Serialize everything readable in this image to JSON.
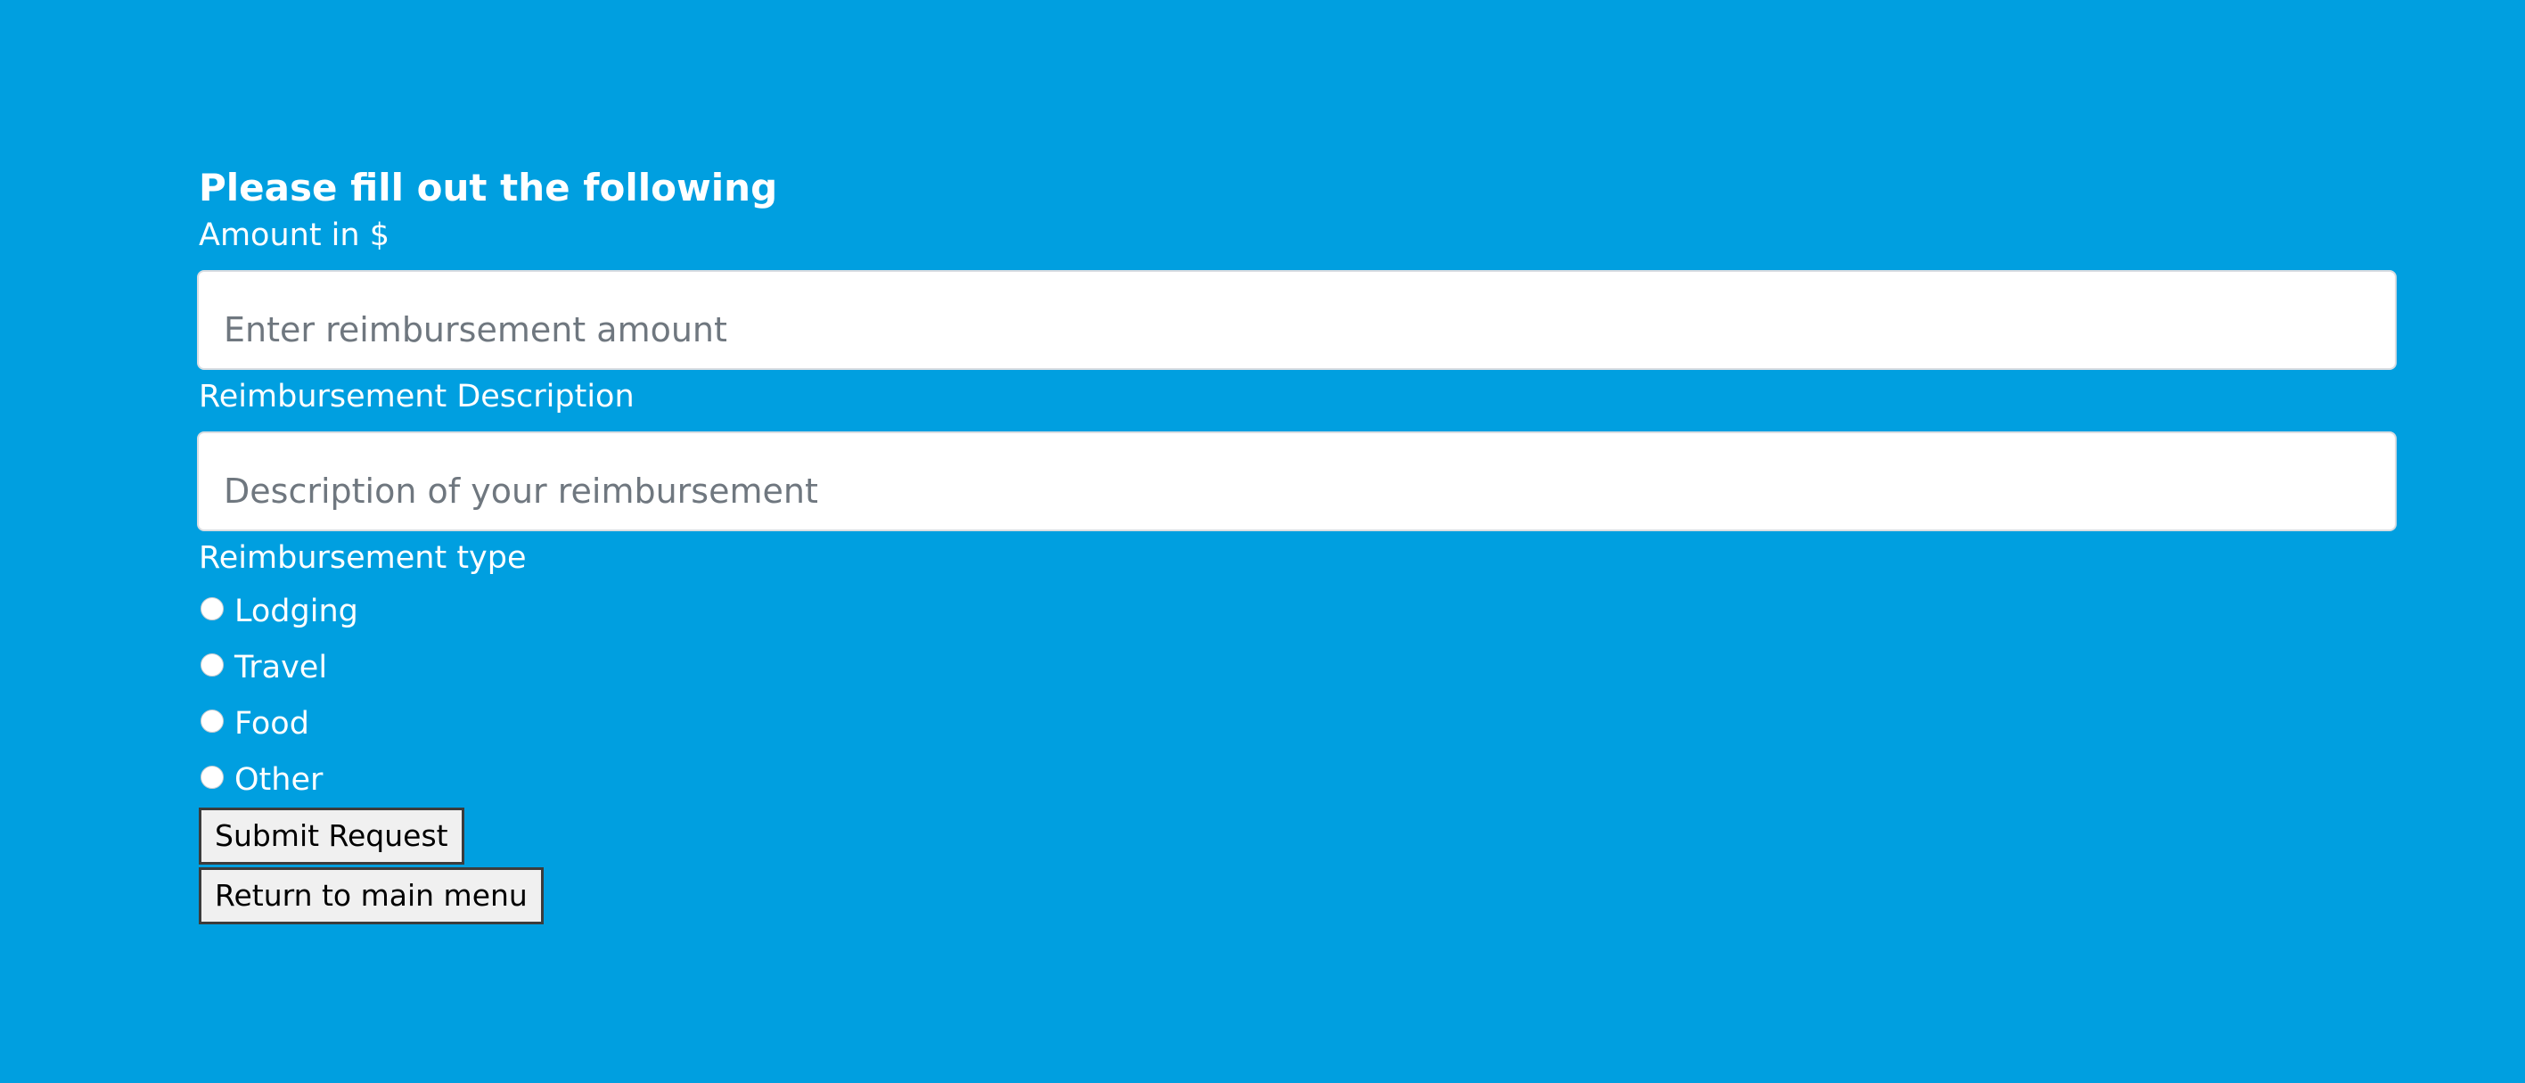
{
  "form": {
    "heading": "Please fill out the following",
    "amount_label": "Amount in $",
    "amount_placeholder": "Enter reimbursement amount",
    "amount_value": "",
    "description_label": "Reimbursement Description",
    "description_placeholder": "Description of your reimbursement",
    "description_value": "",
    "type_label": "Reimbursement type",
    "types": [
      {
        "label": "Lodging",
        "selected": false
      },
      {
        "label": "Travel",
        "selected": false
      },
      {
        "label": "Food",
        "selected": false
      },
      {
        "label": "Other",
        "selected": false
      }
    ],
    "submit_label": "Submit Request",
    "return_label": "Return to main menu"
  },
  "colors": {
    "background": "#009fe0",
    "text": "#ffffff",
    "button_bg": "#f0f0f0"
  }
}
